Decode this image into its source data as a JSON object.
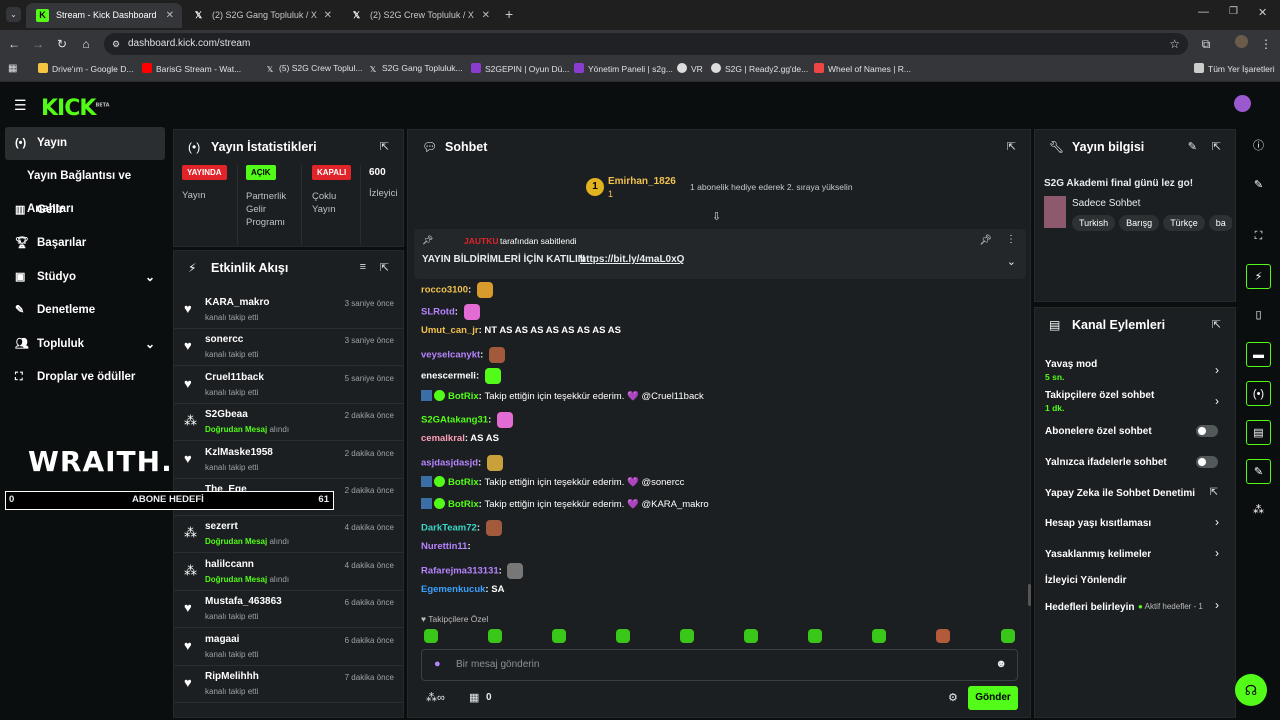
{
  "browser": {
    "tabs": [
      {
        "title": "Stream - Kick Dashboard",
        "active": true
      },
      {
        "title": "(2) S2G Gang Topluluk / X"
      },
      {
        "title": "(2) S2G Crew Topluluk / X"
      }
    ],
    "url": "dashboard.kick.com/stream",
    "bookmarks": [
      "Drive'ım - Google D...",
      "BarisG Stream - Wat...",
      "(5) S2G Crew Toplul...",
      "S2G Gang Topluluk...",
      "S2GEPIN | Oyun Dü...",
      "Yönetim Paneli | s2g...",
      "VR",
      "S2G | Ready2.gg'de...",
      "Wheel of Names | R..."
    ],
    "bookmarks_folder": "Tüm Yer İşaretleri"
  },
  "brand": {
    "logo": "KICK",
    "logo_sup": "BETA",
    "accent": "#53fc18"
  },
  "sidebar": {
    "items": [
      {
        "label": "Yayın",
        "icon": "broadcast-icon"
      },
      {
        "label": "Yayın Bağlantısı ve Anahtarı",
        "icon": ""
      },
      {
        "label": "Gelir",
        "icon": "chart-icon"
      },
      {
        "label": "Başarılar",
        "icon": "trophy-icon"
      },
      {
        "label": "Stüdyo",
        "icon": "studio-icon"
      },
      {
        "label": "Denetleme",
        "icon": "wrench-icon"
      },
      {
        "label": "Topluluk",
        "icon": "people-icon"
      },
      {
        "label": "Droplar ve ödüller",
        "icon": "gift-icon"
      }
    ]
  },
  "overlay": {
    "wraith": "WRAITH.",
    "goal_start": "0",
    "goal_label": "ABONE HEDEFİ",
    "goal_end": "61"
  },
  "stats": {
    "title": "Yayın İstatistikleri",
    "items": [
      {
        "badge": "YAYINDA",
        "label": "Yayın"
      },
      {
        "badge": "AÇIK",
        "label": "Partnerlik Gelir Programı"
      },
      {
        "badge": "KAPALI",
        "label": "Çoklu Yayın"
      },
      {
        "badge": "600",
        "label": "İzleyici"
      }
    ]
  },
  "activity": {
    "title": "Etkinlik Akışı",
    "events": [
      {
        "user": "KARA_makro",
        "action": "kanalı takip etti",
        "time": "3 saniye önce",
        "dm": false
      },
      {
        "user": "sonercc",
        "action": "kanalı takip etti",
        "time": "3 saniye önce",
        "dm": false
      },
      {
        "user": "Cruel11back",
        "action": "kanalı takip etti",
        "time": "5 saniye önce",
        "dm": false
      },
      {
        "user": "S2Gbeaa",
        "action_dm": "Doğrudan Mesaj",
        "action": "alındı",
        "time": "2 dakika önce",
        "dm": true
      },
      {
        "user": "KzlMaske1958",
        "action": "kanalı takip etti",
        "time": "2 dakika önce",
        "dm": false
      },
      {
        "user": "The_Ege",
        "action": "kanalı takip etti",
        "time": "2 dakika önce",
        "dm": false
      },
      {
        "user": "sezerrt",
        "action_dm": "Doğrudan Mesaj",
        "action": "alındı",
        "time": "4 dakika önce",
        "dm": true
      },
      {
        "user": "halilccann",
        "action_dm": "Doğrudan Mesaj",
        "action": "alındı",
        "time": "4 dakika önce",
        "dm": true
      },
      {
        "user": "Mustafa_463863",
        "action": "kanalı takip etti",
        "time": "6 dakika önce",
        "dm": false
      },
      {
        "user": "magaai",
        "action": "kanalı takip etti",
        "time": "6 dakika önce",
        "dm": false
      },
      {
        "user": "RipMelihhh",
        "action": "kanalı takip etti",
        "time": "7 dakika önce",
        "dm": false
      }
    ]
  },
  "chat": {
    "title": "Sohbet",
    "top_gifter": {
      "name": "Emirhan_1826",
      "count": "1",
      "note": "1 abonelik hediye ederek 2. sıraya yükselin"
    },
    "pinned": {
      "by": "JAUTKU",
      "by_suffix": "tarafından sabitlendi",
      "text": "YAYIN BİLDİRİMLERİ İÇİN KATILIN",
      "link": "https://bit.ly/4maL0xQ"
    },
    "messages": [
      {
        "user": "rocco3100",
        "color": "#f2c14e",
        "text": "",
        "emote": "#d99b2b"
      },
      {
        "user": "SLRotd",
        "color": "#b783ff",
        "text": "",
        "emote": "#e36cd4"
      },
      {
        "user": "Umut_can_jr",
        "color": "#f2c14e",
        "text": "NT AS AS AS AS AS AS AS AS",
        "emote": ""
      },
      {
        "user": "veyselcanykt",
        "color": "#b783ff",
        "text": "",
        "emote": "#a35a3c"
      },
      {
        "user": "enescermeli",
        "color": "#ffffff",
        "text": "",
        "emote": "#53fc18"
      },
      {
        "user": "BotRix",
        "color": "#53fc18",
        "text": "Takip ettiğin için teşekkür ederim. 💜 @Cruel11back",
        "emote": ""
      },
      {
        "user": "S2GAtakang31",
        "color": "#53fc18",
        "text": "",
        "emote": "#e36cd4"
      },
      {
        "user": "cemalkral",
        "color": "#ff9fb8",
        "text": "AS AS",
        "emote": ""
      },
      {
        "user": "asjdasjdasjd",
        "color": "#b783ff",
        "text": "",
        "emote": "#c9a13a"
      },
      {
        "user": "BotRix",
        "color": "#53fc18",
        "text": "Takip ettiğin için teşekkür ederim. 💜 @sonercc",
        "emote": ""
      },
      {
        "user": "BotRix",
        "color": "#53fc18",
        "text": "Takip ettiğin için teşekkür ederim. 💜 @KARA_makro",
        "emote": ""
      },
      {
        "user": "DarkTeam72",
        "color": "#3ad6c6",
        "text": "",
        "emote": "#a35a3c"
      },
      {
        "user": "Nurettin11",
        "color": "#b783ff",
        "text": "",
        "emote": ""
      },
      {
        "user": "Rafarejma313131",
        "color": "#b783ff",
        "text": "",
        "emote": "#777777"
      },
      {
        "user": "Egemenkucuk",
        "color": "#3aa0ff",
        "text": "SA",
        "emote": ""
      }
    ],
    "followers_only": "Takipçilere Özel",
    "input_placeholder": "Bir mesaj gönderin",
    "bottom_count": "0",
    "send_label": "Gönder"
  },
  "stream_info": {
    "title": "Yayın bilgisi",
    "stream_title": "S2G Akademi final günü lez go!",
    "category": "Sadece Sohbet",
    "tags": [
      "Turkish",
      "Barışg",
      "Türkçe",
      "ba"
    ]
  },
  "channel_actions": {
    "title": "Kanal Eylemleri",
    "slow_mode": {
      "label": "Yavaş mod",
      "value": "5 sn."
    },
    "followers_chat": {
      "label": "Takipçilere özel sohbet",
      "value": "1 dk."
    },
    "sub_chat": "Abonelere özel sohbet",
    "emote_chat": "Yalnızca ifadelerle sohbet",
    "ai_mod": "Yapay Zeka ile Sohbet Denetimi",
    "age": "Hesap yaşı kısıtlaması",
    "banned": "Yasaklanmış kelimeler",
    "redirect": "İzleyici Yönlendir",
    "goals": "Hedefleri belirleyin",
    "goals_active": "Aktif hedefler - 1"
  }
}
